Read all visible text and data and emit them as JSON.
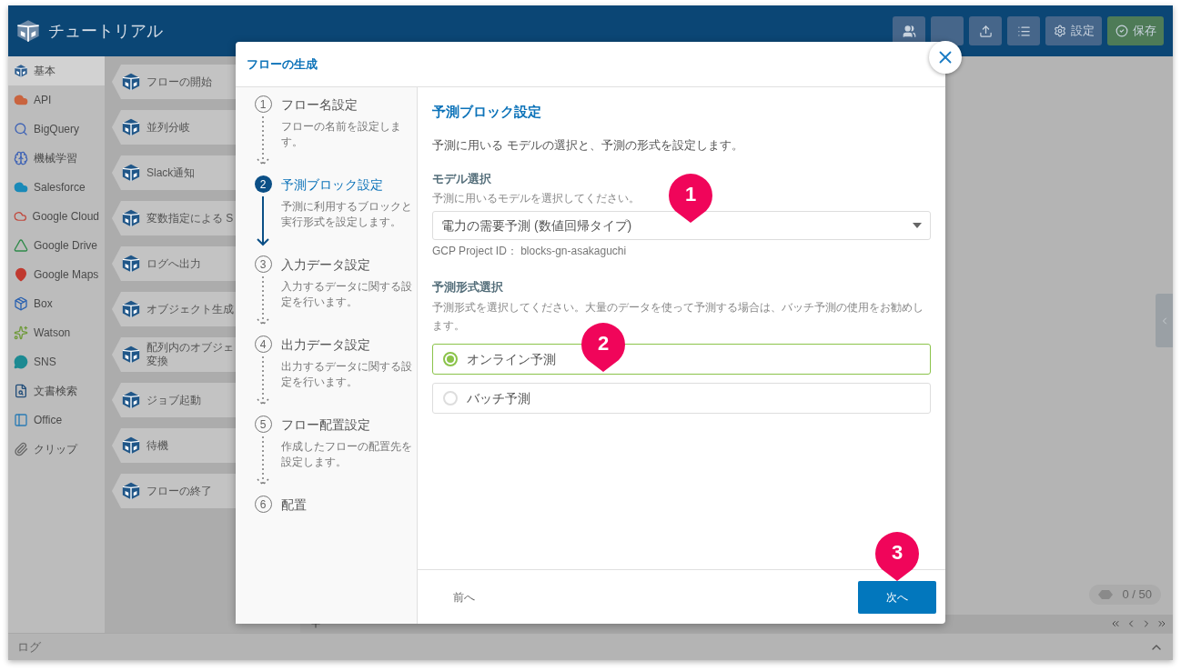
{
  "header": {
    "title": "チュートリアル",
    "buttons": [
      {
        "kind": "people"
      },
      {
        "kind": "blank"
      },
      {
        "kind": "upload"
      },
      {
        "kind": "list"
      },
      {
        "kind": "settings",
        "label": "設定"
      },
      {
        "kind": "save",
        "label": "保存"
      }
    ]
  },
  "sidebar": {
    "items": [
      {
        "kind": "basic",
        "label": "基本",
        "selected": true
      },
      {
        "kind": "api",
        "label": "API",
        "selected": false
      },
      {
        "kind": "bigquery",
        "label": "BigQuery",
        "selected": false
      },
      {
        "kind": "ml",
        "label": "機械学習",
        "selected": false
      },
      {
        "kind": "salesforce",
        "label": "Salesforce",
        "selected": false
      },
      {
        "kind": "google_cloud",
        "label": "Google Cloud",
        "selected": false
      },
      {
        "kind": "google_drive",
        "label": "Google Drive",
        "selected": false
      },
      {
        "kind": "google_maps",
        "label": "Google Maps",
        "selected": false
      },
      {
        "kind": "box",
        "label": "Box",
        "selected": false
      },
      {
        "kind": "watson",
        "label": "Watson",
        "selected": false
      },
      {
        "kind": "sns",
        "label": "SNS",
        "selected": false
      },
      {
        "kind": "doc_search",
        "label": "文書検索",
        "selected": false
      },
      {
        "kind": "office",
        "label": "Office",
        "selected": false
      },
      {
        "kind": "clip",
        "label": "クリップ",
        "selected": false
      }
    ]
  },
  "blocks": [
    {
      "label": "フローの開始"
    },
    {
      "label": "並列分岐"
    },
    {
      "label": "Slack通知"
    },
    {
      "label": "変数指定による S"
    },
    {
      "label": "ログへ出力"
    },
    {
      "label": "オブジェクト生成"
    },
    {
      "label": "配列内のオブジェ変換"
    },
    {
      "label": "ジョブ起動"
    },
    {
      "label": "待機"
    },
    {
      "label": "フローの終了"
    }
  ],
  "canvas": {
    "counter": "0 / 50"
  },
  "log_bar": {
    "title": "ログ"
  },
  "modal": {
    "title": "フローの生成",
    "steps": [
      {
        "number": "1",
        "title": "フロー名設定",
        "description": "フローの名前を設定します。",
        "selected": false
      },
      {
        "number": "2",
        "title": "予測ブロック設定",
        "description": "予測に利用するブロックと実行形式を設定します。",
        "selected": true
      },
      {
        "number": "3",
        "title": "入力データ設定",
        "description": "入力するデータに関する設定を行います。",
        "selected": false
      },
      {
        "number": "4",
        "title": "出力データ設定",
        "description": "出力するデータに関する設定を行います。",
        "selected": false
      },
      {
        "number": "5",
        "title": "フロー配置設定",
        "description": "作成したフローの配置先を設定します。",
        "selected": false
      },
      {
        "number": "6",
        "title": "配置",
        "selected": false
      }
    ],
    "content": {
      "title": "予測ブロック設定",
      "description": "予測に用いる モデルの選択と、予測の形式を設定します。",
      "model": {
        "label": "モデル選択",
        "hint": "予測に用いるモデルを選択してください。",
        "value": "電力の需要予測 (数値回帰タイプ)",
        "project": "GCP Project ID： blocks-gn-asakaguchi",
        "marker": "1"
      },
      "format": {
        "label": "予測形式選択",
        "hint": "予測形式を選択してください。大量のデータを使って予測する場合は、バッチ予測の使用をお勧めします。",
        "marker": "2",
        "options": [
          {
            "label": "オンライン予測",
            "selected": true
          },
          {
            "label": "バッチ予測",
            "selected": false
          }
        ]
      }
    },
    "footer": {
      "back": "前へ",
      "next": "次へ",
      "marker": "3"
    }
  }
}
